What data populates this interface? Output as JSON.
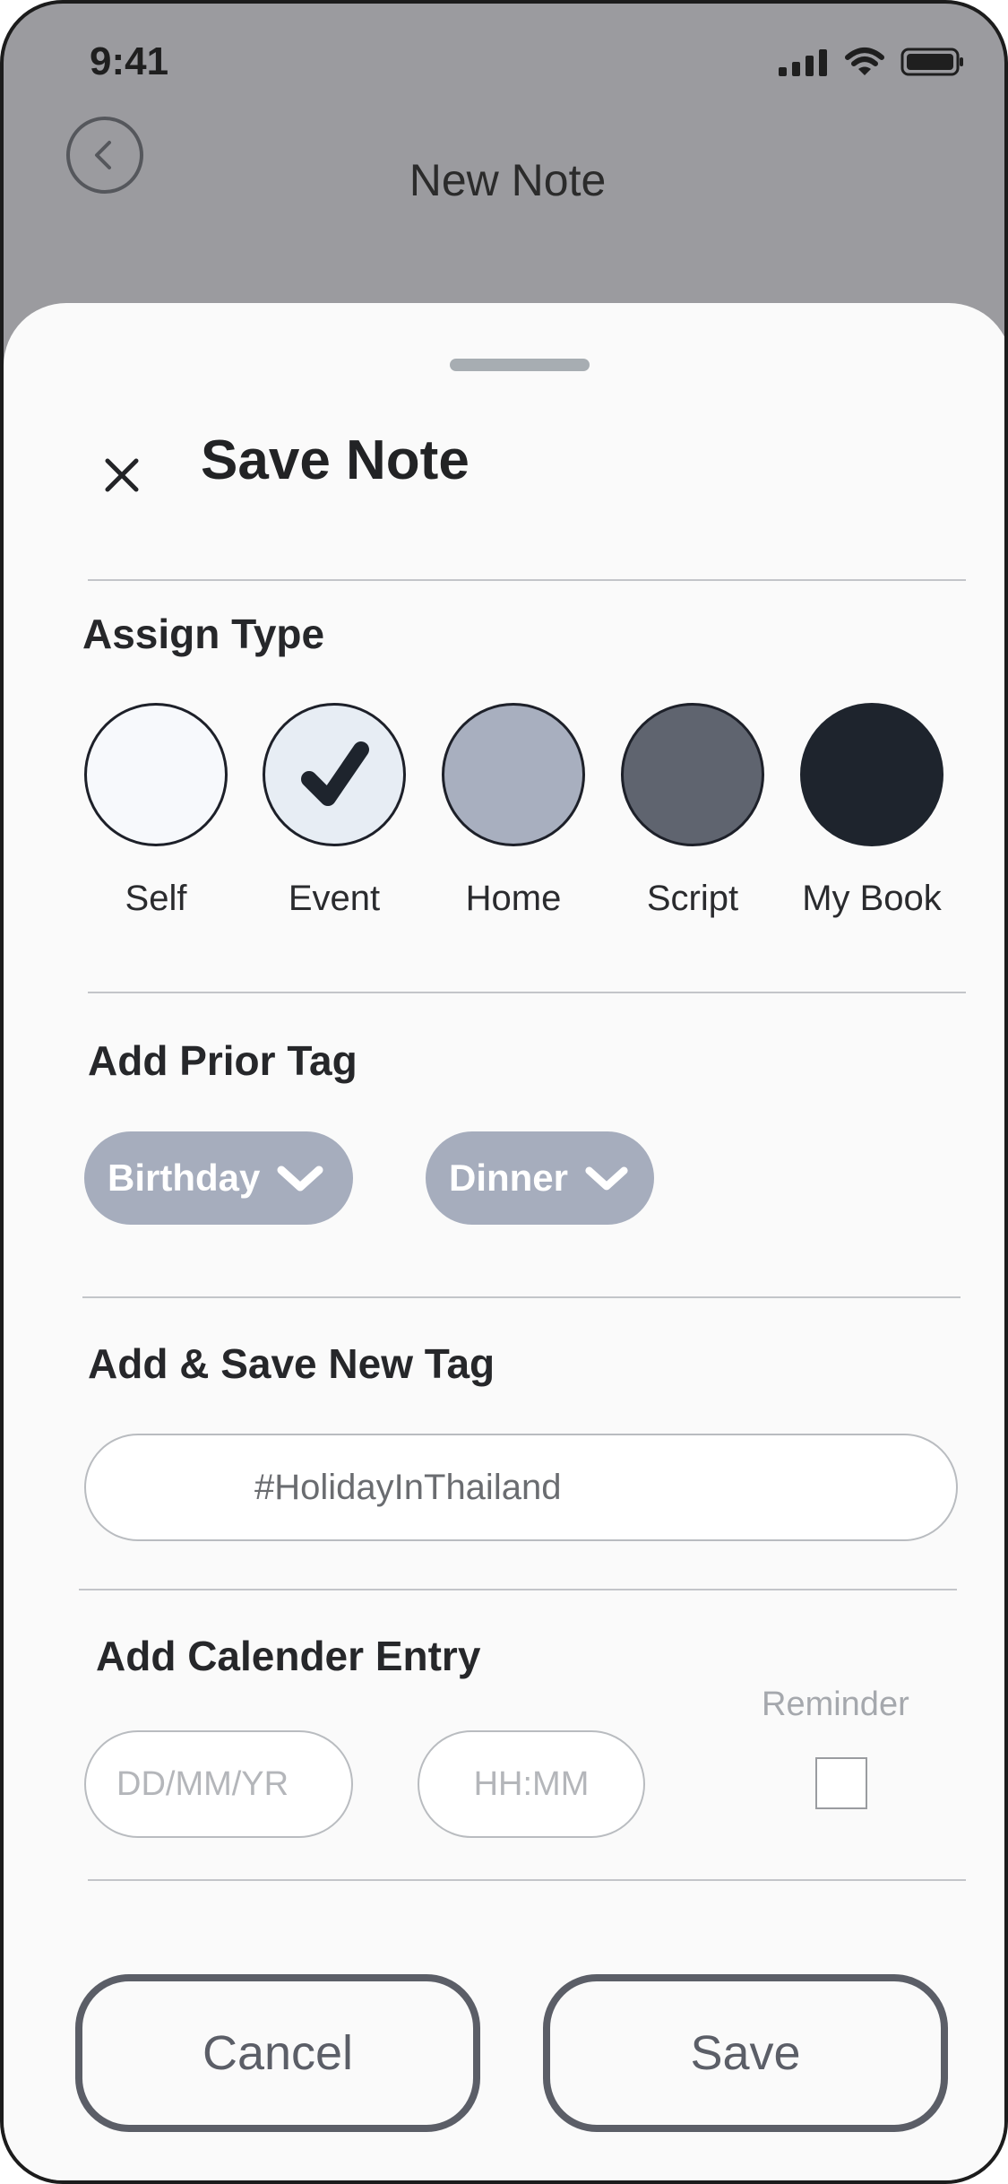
{
  "status_bar": {
    "time": "9:41"
  },
  "header": {
    "title": "New Note"
  },
  "sheet": {
    "title": "Save Note"
  },
  "assign_type": {
    "label": "Assign Type",
    "options": [
      {
        "label": "Self",
        "color": "#f7f9fc",
        "selected": false
      },
      {
        "label": "Event",
        "color": "#e7edf4",
        "selected": true
      },
      {
        "label": "Home",
        "color": "#a8afbf",
        "selected": false
      },
      {
        "label": "Script",
        "color": "#5f646f",
        "selected": false
      },
      {
        "label": "My Book",
        "color": "#1e242d",
        "selected": false
      }
    ]
  },
  "prior_tags": {
    "label": "Add Prior Tag",
    "tags": [
      "Birthday",
      "Dinner"
    ]
  },
  "new_tag": {
    "label": "Add & Save New Tag",
    "value": "#HolidayInThailand"
  },
  "calendar": {
    "label": "Add Calender Entry",
    "date_placeholder": "DD/MM/YR",
    "time_placeholder": "HH:MM",
    "reminder_label": "Reminder"
  },
  "actions": {
    "cancel": "Cancel",
    "save": "Save"
  }
}
